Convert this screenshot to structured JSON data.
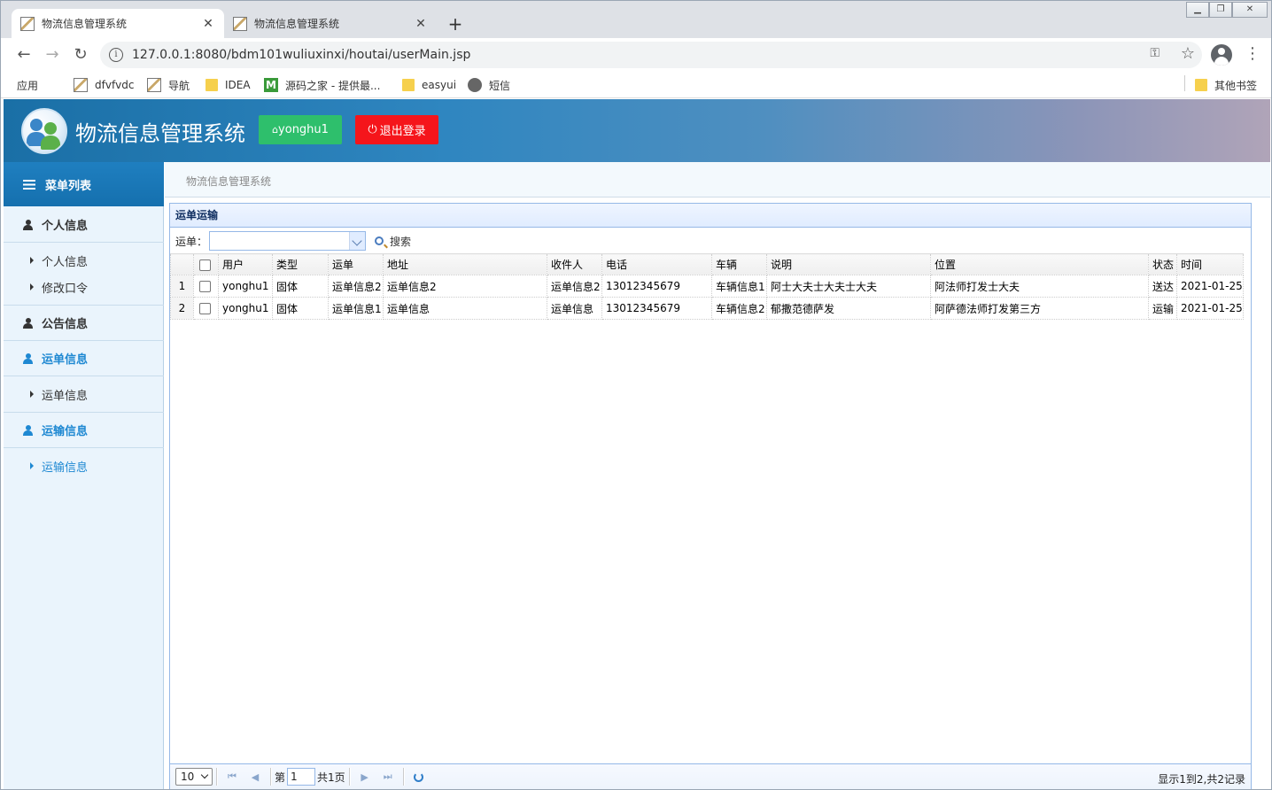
{
  "browser": {
    "tabs": [
      {
        "title": "物流信息管理系统",
        "active": true
      },
      {
        "title": "物流信息管理系统",
        "active": false
      }
    ],
    "url": "127.0.0.1:8080/bdm101wuliuxinxi/houtai/userMain.jsp",
    "bookmarks": [
      {
        "label": "应用",
        "icon": "apps-grid-icon"
      },
      {
        "label": "dfvfvdc",
        "icon": "page-image-icon"
      },
      {
        "label": "导航",
        "icon": "page-image-icon"
      },
      {
        "label": "IDEA",
        "icon": "folder-icon"
      },
      {
        "label": "源码之家 - 提供最...",
        "icon": "m-logo-icon"
      },
      {
        "label": "easyui",
        "icon": "folder-icon"
      },
      {
        "label": "短信",
        "icon": "globe-icon"
      }
    ],
    "other_bookmarks": "其他书签"
  },
  "header": {
    "title": "物流信息管理系统",
    "user_button": "yonghu1",
    "logout_button": "退出登录"
  },
  "sidebar": {
    "heading": "菜单列表",
    "sections": [
      {
        "label": "个人信息",
        "items": [
          "个人信息",
          "修改口令"
        ]
      },
      {
        "label": "公告信息",
        "items": []
      },
      {
        "label": "运单信息",
        "items": [
          "运单信息"
        ]
      },
      {
        "label": "运输信息",
        "items": [
          "运输信息"
        ]
      }
    ]
  },
  "breadcrumb": "物流信息管理系统",
  "panel": {
    "title": "运单运输",
    "search_label": "运单：",
    "search_value": "",
    "search_button": "搜索"
  },
  "table": {
    "columns": [
      "用户",
      "类型",
      "运单",
      "地址",
      "收件人",
      "电话",
      "车辆",
      "说明",
      "位置",
      "状态",
      "时间"
    ],
    "rows": [
      {
        "rownum": "1",
        "cells": [
          "yonghu1",
          "固体",
          "运单信息2",
          "运单信息2",
          "运单信息2",
          "13012345679",
          "车辆信息1",
          "阿士大夫士大夫士大夫",
          "阿法师打发士大夫",
          "送达",
          "2021-01-25"
        ]
      },
      {
        "rownum": "2",
        "cells": [
          "yonghu1",
          "固体",
          "运单信息1",
          "运单信息",
          "运单信息",
          "13012345679",
          "车辆信息2",
          "郁撒范德萨发",
          "阿萨德法师打发第三方",
          "运输",
          "2021-01-25"
        ]
      }
    ]
  },
  "pager": {
    "page_size": "10",
    "page_prefix": "第",
    "page_number": "1",
    "page_total": "共1页",
    "info": "显示1到2,共2记录"
  }
}
